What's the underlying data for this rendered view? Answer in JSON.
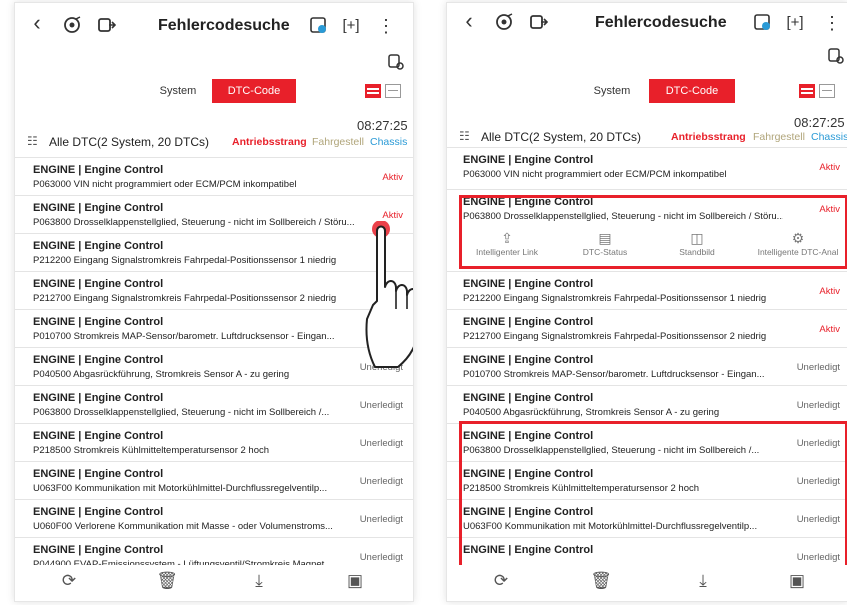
{
  "header": {
    "title": "Fehlercodesuche",
    "back": "‹",
    "more": "⋮"
  },
  "tabs": {
    "system": "System",
    "dtc": "DTC-Code"
  },
  "summary": {
    "label": "Alle DTC(2 System, 20 DTCs)",
    "time": "08:27:25",
    "filter_antrieb": "Antriebsstrang",
    "filter_fahr": "Fahrgestell",
    "filter_chassis": "Chassis"
  },
  "left_rows": [
    {
      "title": "ENGINE | Engine Control",
      "desc": "P063000 VIN nicht programmiert oder ECM/PCM inkompatibel",
      "status": "Aktiv"
    },
    {
      "title": "ENGINE | Engine Control",
      "desc": "P063800 Drosselklappenstellglied, Steuerung - nicht im Sollbereich / Störu...",
      "status": "Aktiv"
    },
    {
      "title": "ENGINE | Engine Control",
      "desc": "P212200 Eingang Signalstromkreis Fahrpedal-Positionssensor 1 niedrig",
      "status": ""
    },
    {
      "title": "ENGINE | Engine Control",
      "desc": "P212700 Eingang Signalstromkreis Fahrpedal-Positionssensor 2 niedrig",
      "status": ""
    },
    {
      "title": "ENGINE | Engine Control",
      "desc": "P010700 Stromkreis MAP-Sensor/barometr. Luftdrucksensor - Eingan...",
      "status": "Un"
    },
    {
      "title": "ENGINE | Engine Control",
      "desc": "P040500 Abgasrückführung, Stromkreis Sensor A - zu gering",
      "status": "Unerledigt"
    },
    {
      "title": "ENGINE | Engine Control",
      "desc": "P063800 Drosselklappenstellglied, Steuerung - nicht im Sollbereich /...",
      "status": "Unerledigt"
    },
    {
      "title": "ENGINE | Engine Control",
      "desc": "P218500 Stromkreis Kühlmitteltemperatursensor 2 hoch",
      "status": "Unerledigt"
    },
    {
      "title": "ENGINE | Engine Control",
      "desc": "U063F00 Kommunikation mit Motorkühlmittel-Durchflussregelventilp...",
      "status": "Unerledigt"
    },
    {
      "title": "ENGINE | Engine Control",
      "desc": "U060F00 Verlorene Kommunikation mit Masse - oder Volumenstroms...",
      "status": "Unerledigt"
    },
    {
      "title": "ENGINE | Engine Control",
      "desc": "P044900 EVAP-Emissionssystem - Lüftungsventil/Stromkreis Magnet...",
      "status": "Unerledigt"
    }
  ],
  "right_rows": [
    {
      "title": "ENGINE | Engine Control",
      "desc": "P063000 VIN nicht programmiert oder ECM/PCM inkompatibel",
      "status": "Aktiv"
    },
    {
      "title": "ENGINE | Engine Control",
      "desc": "P063800 Drosselklappenstellglied, Steuerung - nicht im Sollbereich / Störu...",
      "status": "Aktiv"
    },
    {
      "title": "ENGINE | Engine Control",
      "desc": "P212200 Eingang Signalstromkreis Fahrpedal-Positionssensor 1 niedrig",
      "status": "Aktiv"
    },
    {
      "title": "ENGINE | Engine Control",
      "desc": "P212700 Eingang Signalstromkreis Fahrpedal-Positionssensor 2 niedrig",
      "status": "Aktiv"
    },
    {
      "title": "ENGINE | Engine Control",
      "desc": "P010700 Stromkreis MAP-Sensor/barometr. Luftdrucksensor - Eingan...",
      "status": "Unerledigt"
    },
    {
      "title": "ENGINE | Engine Control",
      "desc": "P040500 Abgasrückführung, Stromkreis Sensor A - zu gering",
      "status": "Unerledigt"
    },
    {
      "title": "ENGINE | Engine Control",
      "desc": "P063800 Drosselklappenstellglied, Steuerung - nicht im Sollbereich /...",
      "status": "Unerledigt"
    },
    {
      "title": "ENGINE | Engine Control",
      "desc": "P218500 Stromkreis Kühlmitteltemperatursensor 2 hoch",
      "status": "Unerledigt"
    },
    {
      "title": "ENGINE | Engine Control",
      "desc": "U063F00 Kommunikation mit Motorkühlmittel-Durchflussregelventilp...",
      "status": "Unerledigt"
    },
    {
      "title": "ENGINE | Engine Control",
      "desc": "",
      "status": "Unerledigt"
    }
  ],
  "actions": {
    "link": "Intelligenter Link",
    "status": "DTC-Status",
    "freeze": "Standbild",
    "analysis": "Intelligente DTC-Anal"
  },
  "colors": {
    "accent": "#e8202a",
    "chassis": "#2a9ad6",
    "fahrgestell": "#b0a57a"
  }
}
